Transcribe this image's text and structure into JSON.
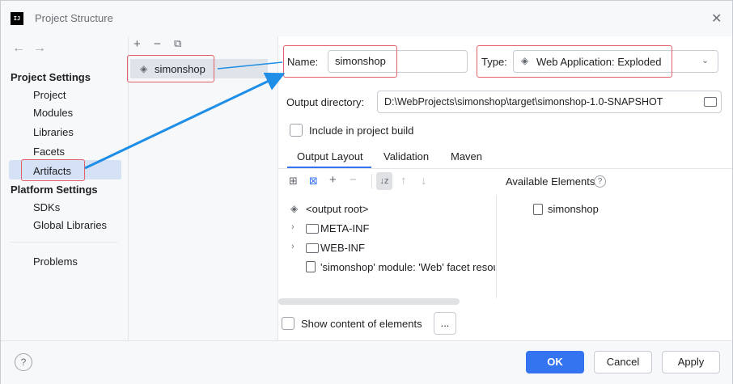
{
  "window": {
    "title": "Project Structure"
  },
  "app_icon_text": "IJ",
  "left_nav": {
    "project_settings": "Project Settings",
    "items_project": [
      "Project",
      "Modules",
      "Libraries",
      "Facets",
      "Artifacts"
    ],
    "platform_settings": "Platform Settings",
    "items_platform": [
      "SDKs",
      "Global Libraries"
    ],
    "problems": "Problems",
    "selected": "Artifacts"
  },
  "artifacts": {
    "items": [
      {
        "name": "simonshop"
      }
    ]
  },
  "form": {
    "name_label": "Name:",
    "name_value": "simonshop",
    "type_label": "Type:",
    "type_value": "Web Application: Exploded",
    "output_dir_label": "Output directory:",
    "output_dir_value": "D:\\WebProjects\\simonshop\\target\\simonshop-1.0-SNAPSHOT",
    "include_label": "Include in project build"
  },
  "tabs": [
    "Output Layout",
    "Validation",
    "Maven"
  ],
  "active_tab": "Output Layout",
  "layout_tree": {
    "root": "<output root>",
    "children": [
      "META-INF",
      "WEB-INF"
    ],
    "facet_resource": "'simonshop' module: 'Web' facet resou"
  },
  "available": {
    "title": "Available Elements",
    "items": [
      "simonshop"
    ]
  },
  "show_content_label": "Show content of elements",
  "ellipsis_button": "...",
  "buttons": {
    "ok": "OK",
    "cancel": "Cancel",
    "apply": "Apply",
    "help": "?"
  },
  "colors": {
    "accent": "#3574f0",
    "highlight": "#e3606a",
    "selection": "#d5e1f5"
  }
}
